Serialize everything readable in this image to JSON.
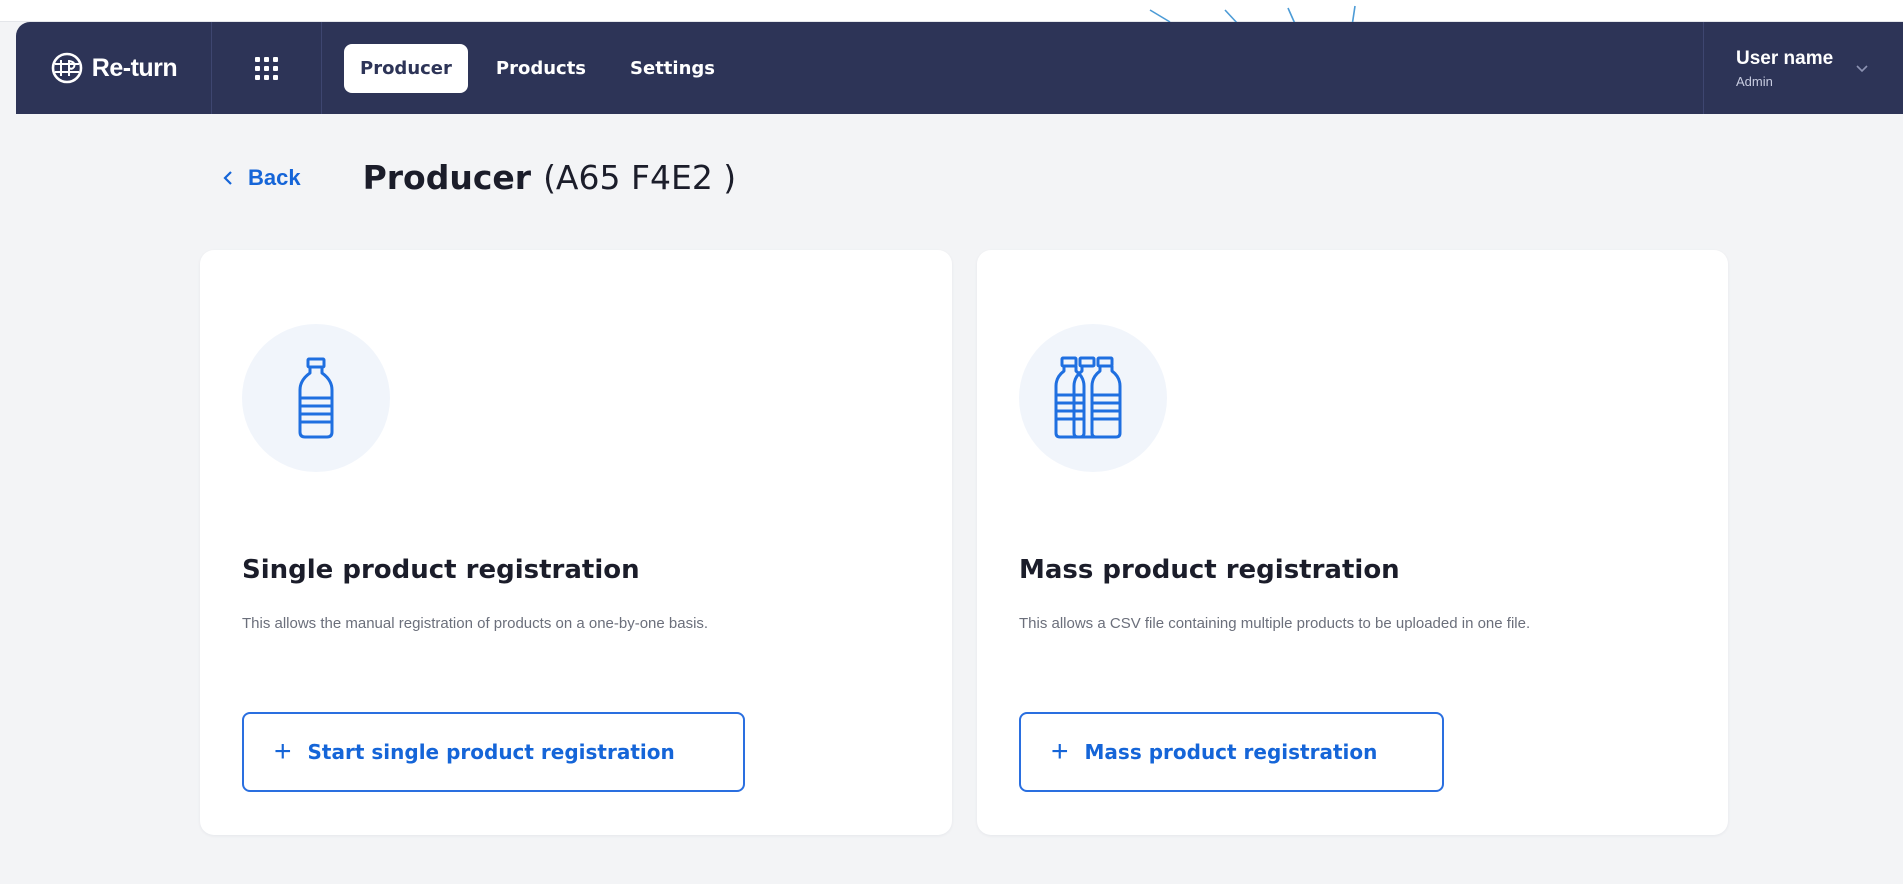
{
  "app": {
    "brand_name": "Re-turn",
    "accent_color": "#1565d8",
    "navbar_color": "#2d3457"
  },
  "nav": {
    "tabs": [
      {
        "label": "Producer",
        "active": true
      },
      {
        "label": "Products",
        "active": false
      },
      {
        "label": "Settings",
        "active": false
      }
    ]
  },
  "user": {
    "name": "User name",
    "role": "Admin"
  },
  "page": {
    "back_label": "Back",
    "title": "Producer",
    "code": "(A65 F4E2 )"
  },
  "cards": [
    {
      "icon": "single-bottle-icon",
      "title": "Single product registration",
      "description": "This allows the manual registration of products on a one-by-one basis.",
      "button_label": "Start single product registration"
    },
    {
      "icon": "multiple-bottles-icon",
      "title": "Mass product registration",
      "description": "This allows a CSV file containing multiple products to be uploaded in one file.",
      "button_label": "Mass product registration"
    }
  ]
}
